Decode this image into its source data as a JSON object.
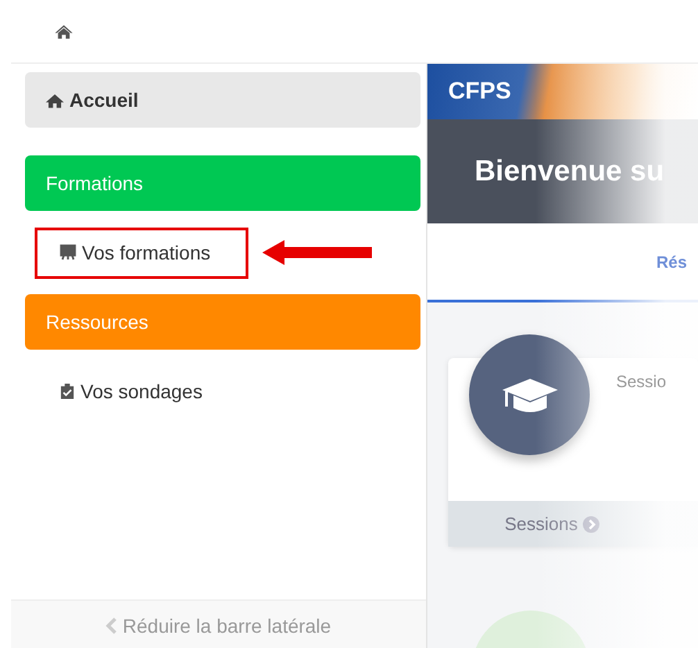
{
  "sidebar": {
    "items": [
      {
        "kind": "link",
        "label": "Accueil"
      },
      {
        "kind": "section",
        "label": "Formations",
        "color": "#00c853"
      },
      {
        "kind": "sub",
        "label": "Vos formations",
        "highlighted": true
      },
      {
        "kind": "section",
        "label": "Ressources",
        "color": "#ff8800"
      },
      {
        "kind": "sub",
        "label": "Vos sondages",
        "highlighted": false
      }
    ],
    "footer": "Réduire la barre latérale"
  },
  "main": {
    "brand": "CFPS",
    "welcome": "Bienvenue su",
    "tab": "Rés",
    "card": {
      "title": "Sessio",
      "footer": "Sessions"
    }
  }
}
